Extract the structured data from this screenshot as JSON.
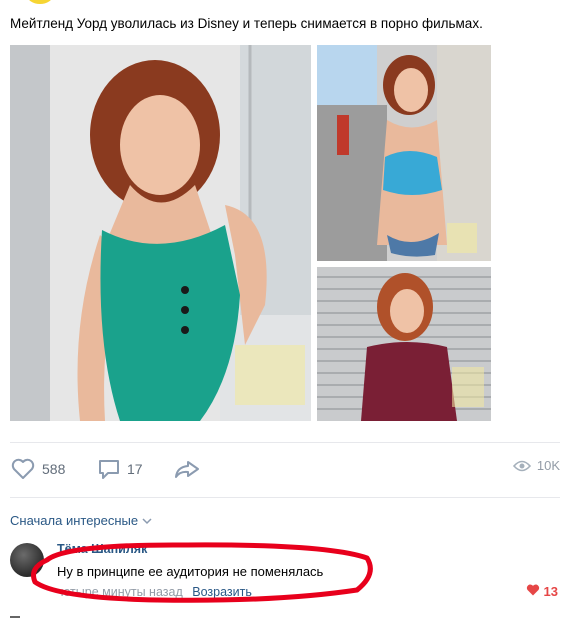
{
  "post": {
    "text": "Мейтленд Уорд уволилась из Disney и теперь снимается в порно фильмах.",
    "photos": [
      {
        "alt": "woman in teal bodysuit in bathroom"
      },
      {
        "alt": "woman in blue striped bikini"
      },
      {
        "alt": "woman in burgundy top near shutter"
      }
    ]
  },
  "actions": {
    "likes": "588",
    "comments": "17",
    "views": "10K"
  },
  "comments": {
    "sort_label": "Сначала интересные",
    "items": [
      {
        "author": "Тёма Шапиляк",
        "text": "Ну в принципе ее аудитория не поменялась",
        "time": "четыре минуты назад",
        "reply_label": "Возразить",
        "likes": "13"
      }
    ]
  },
  "colors": {
    "accent": "#2a5885",
    "like_red": "#e64646",
    "annotation": "#e8001c"
  }
}
